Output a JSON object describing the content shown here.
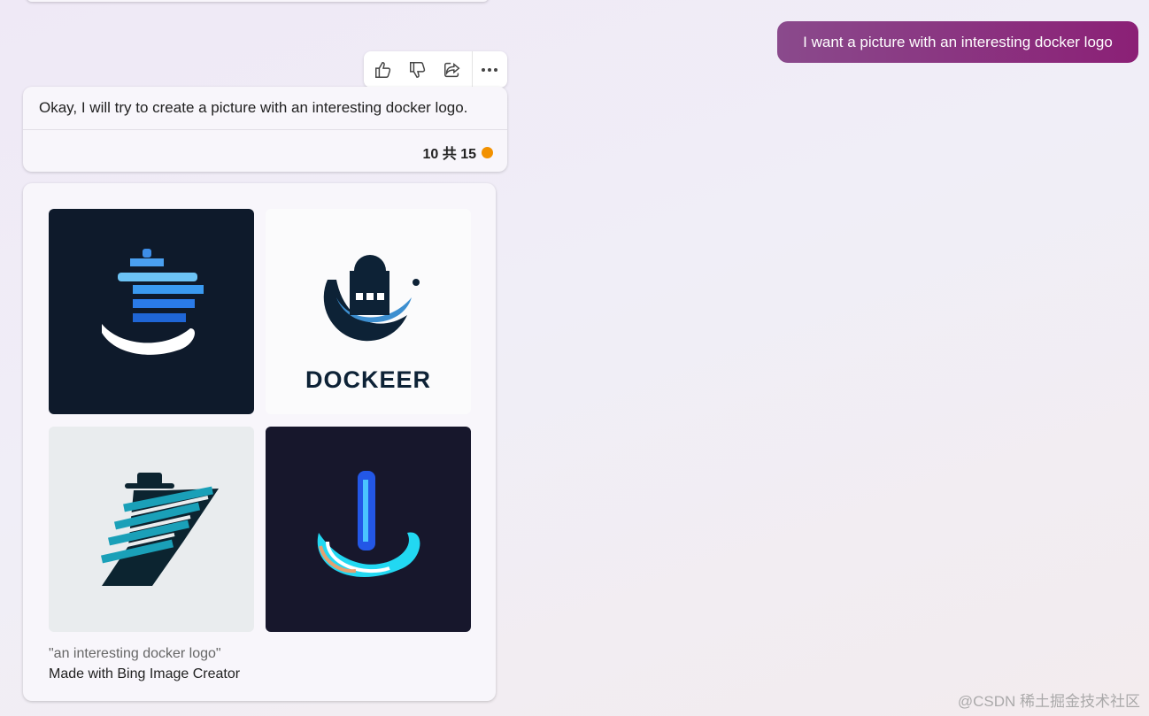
{
  "user_message": "I want a picture with an interesting docker logo",
  "actions": {
    "icons": [
      "thumbs-up-icon",
      "thumbs-down-icon",
      "share-icon",
      "more-icon"
    ]
  },
  "reply": {
    "text": "Okay, I will try to create a picture with an interesting docker logo.",
    "count": "10 共 15",
    "status_color": "#f29100"
  },
  "images": {
    "tiles": [
      {
        "bg": "#0e1a2b"
      },
      {
        "bg": "#fbfbfc",
        "label": "DOCKEER"
      },
      {
        "bg": "#e9ecee"
      },
      {
        "bg": "#17172c"
      }
    ],
    "caption": "\"an interesting docker logo\"",
    "made_with": "Made with Bing Image Creator"
  },
  "watermark": "@CSDN 稀土掘金技术社区"
}
